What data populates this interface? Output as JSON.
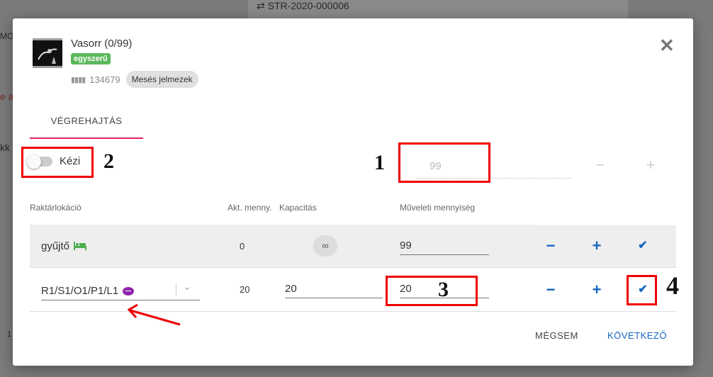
{
  "background": {
    "doc_number": "⇄ STR-2020-000006",
    "frag_left_1": "MOZ",
    "frag_left_2": "e a",
    "frag_left_3": "kk",
    "frag_left_4": "1"
  },
  "product": {
    "name": "Vasorr (0/99)",
    "badge": "egyszerű",
    "barcode_icon": "barcode-icon",
    "barcode": "134679",
    "tag": "Mesés jelmezek"
  },
  "tabs": [
    {
      "label": "VÉGREHAJTÁS"
    }
  ],
  "mode_toggle": {
    "label": "Kézi",
    "on": false
  },
  "quantity_field": {
    "placeholder": "99"
  },
  "table": {
    "headers": {
      "location": "Raktárlokáció",
      "akt": "Akt. menny.",
      "capacity": "Kapacitás",
      "op_qty": "Műveleti mennyiség"
    },
    "rows": [
      {
        "location": "gyűjtő",
        "icon": "bed-icon",
        "akt": "0",
        "capacity": "∞",
        "op_qty": "99"
      },
      {
        "location": "R1/S1/O1/P1/L1",
        "icon": "football-icon",
        "akt": "20",
        "capacity": "20",
        "op_qty": "20"
      }
    ]
  },
  "buttons": {
    "minus": "−",
    "plus": "+",
    "check": "✔",
    "close": "✕",
    "cancel": "MÉGSEM",
    "next": "KÖVETKEZŐ"
  },
  "annotations": [
    "1",
    "2",
    "3",
    "4"
  ],
  "colors": {
    "accent_tab": "#e91e63",
    "action_blue": "#1565c0",
    "badge_green": "#5cb85c",
    "annotation_red": "#e00000"
  }
}
